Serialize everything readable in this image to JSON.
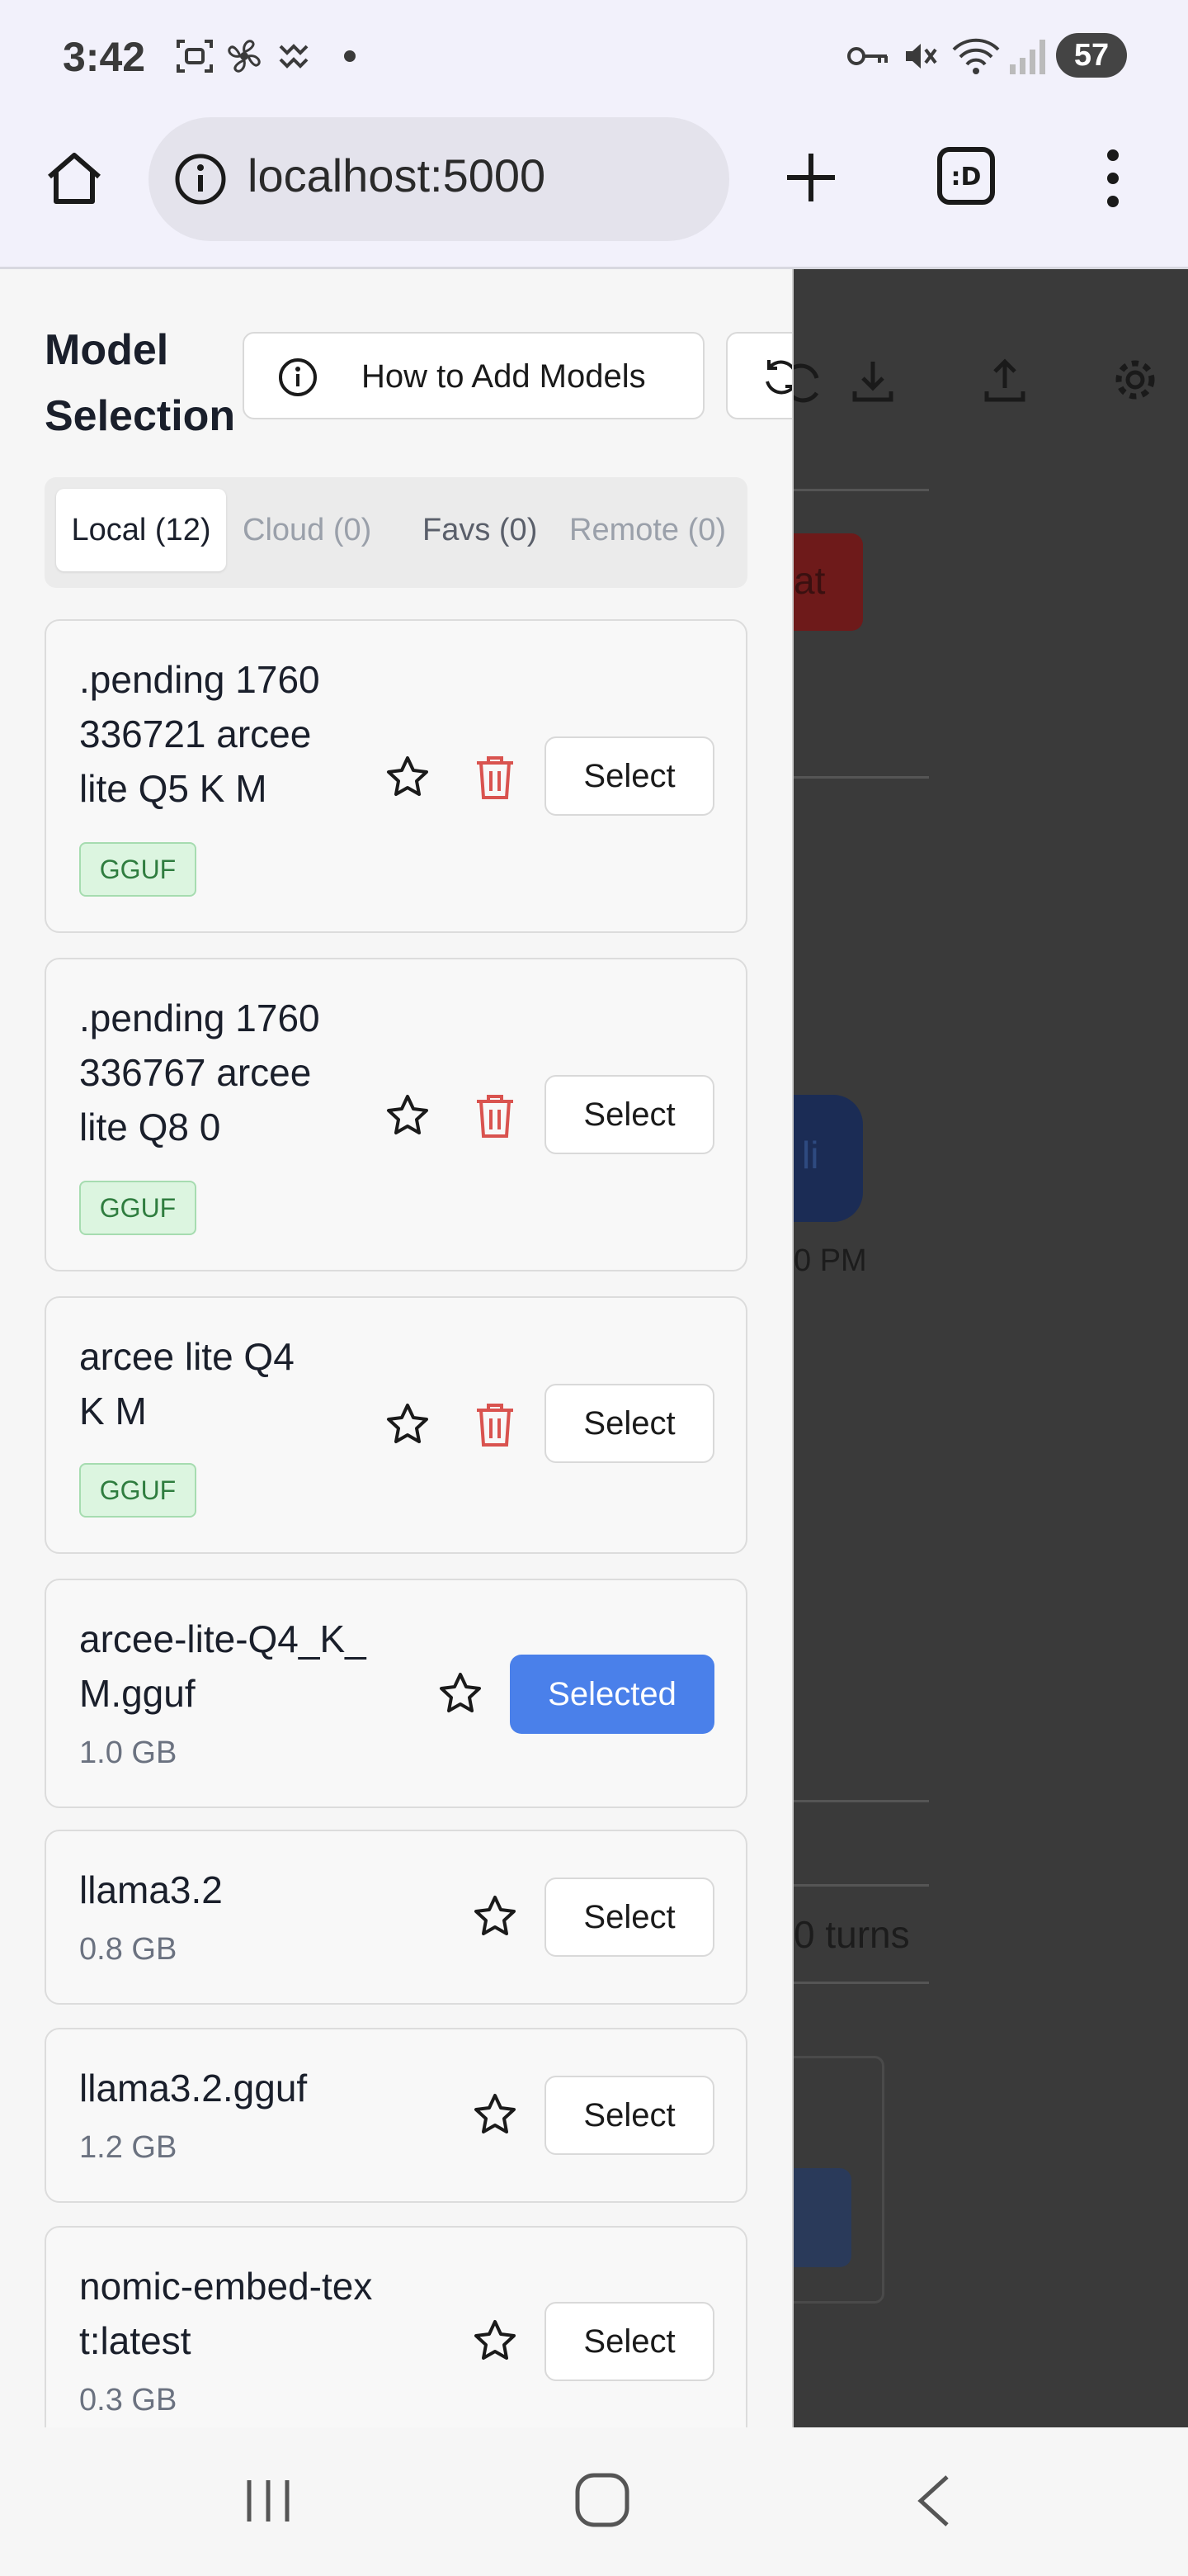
{
  "status_bar": {
    "time": "3:42",
    "battery": "57"
  },
  "browser": {
    "url": "localhost:5000"
  },
  "drawer": {
    "title": "Model Selection",
    "how_to_button": "How to Add Models",
    "tabs": [
      {
        "label": "Local (12)",
        "state": "active"
      },
      {
        "label": "Cloud (0)",
        "state": "inactive"
      },
      {
        "label": "Favs (0)",
        "state": "inactive"
      },
      {
        "label": "Remote (0)",
        "state": "inactive"
      }
    ],
    "models": [
      {
        "name_lines": [
          ".pending 1760",
          "336721 arcee",
          "lite Q5 K M"
        ],
        "badge": "GGUF",
        "action": "Select"
      },
      {
        "name_lines": [
          ".pending 1760",
          "336767 arcee",
          "lite Q8 0"
        ],
        "badge": "GGUF",
        "action": "Select"
      },
      {
        "name_lines": [
          "arcee lite Q4",
          "K M"
        ],
        "badge": "GGUF",
        "action": "Select"
      },
      {
        "name_lines": [
          "arcee-lite-Q4_K_",
          "M.gguf"
        ],
        "size": "1.0 GB",
        "action": "Selected"
      },
      {
        "name_lines": [
          "llama3.2"
        ],
        "size": "0.8 GB",
        "action": "Select"
      },
      {
        "name_lines": [
          "llama3.2.gguf"
        ],
        "size": "1.2 GB",
        "action": "Select"
      },
      {
        "name_lines": [
          "nomic-embed-tex",
          "t:latest"
        ],
        "size": "0.3 GB",
        "action": "Select"
      }
    ]
  },
  "background": {
    "fragment_1": "at",
    "fragment_2": "li",
    "fragment_3": "0 PM",
    "fragment_4": "0 turns"
  },
  "colors": {
    "accent": "#4a80ea",
    "danger": "#d9534f",
    "badge_bg": "#dcf5e0",
    "badge_text": "#2f7d3f",
    "overlay": "#3a3a3a"
  }
}
